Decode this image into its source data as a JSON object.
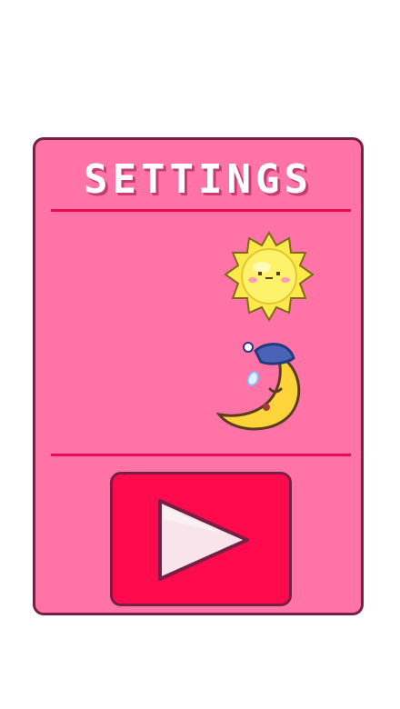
{
  "settings": {
    "title": "SETTINGS"
  },
  "toggles": {
    "sun_icon": "sun-icon",
    "moon_icon": "sleeping-moon-icon"
  },
  "play": {
    "icon": "play-icon"
  },
  "colors": {
    "panel": "#ff73a6",
    "panel_border": "#7a1f44",
    "divider": "#ee0a52",
    "button": "#ff0a4c",
    "sun": "#ffe94a",
    "moon": "#ffd43b",
    "nightcap": "#4a63b7"
  }
}
